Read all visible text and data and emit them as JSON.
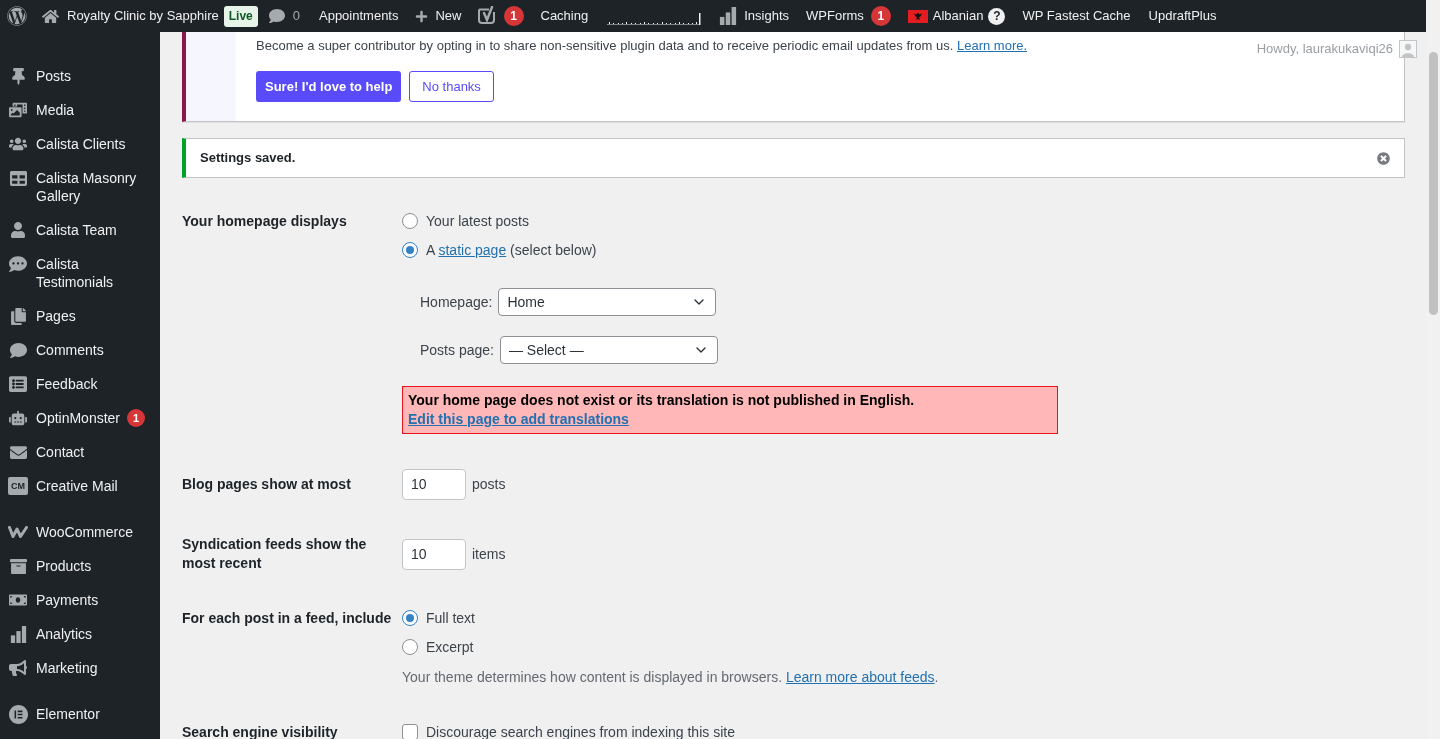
{
  "admin_bar": {
    "items": [
      {
        "kind": "logo"
      },
      {
        "kind": "site",
        "label": "Royalty Clinic by Sapphire",
        "badge": "Live"
      },
      {
        "kind": "comments",
        "count": "0"
      },
      {
        "kind": "text",
        "label": "Appointments"
      },
      {
        "kind": "new",
        "label": "New"
      },
      {
        "kind": "seo",
        "count": "1"
      },
      {
        "kind": "text",
        "label": "Caching"
      },
      {
        "kind": "stats"
      },
      {
        "kind": "insights",
        "label": "Insights"
      },
      {
        "kind": "text",
        "label": "WPForms",
        "count": "1"
      },
      {
        "kind": "language",
        "label": "Albanian",
        "help": "?"
      },
      {
        "kind": "text",
        "label": "WP Fastest Cache"
      },
      {
        "kind": "text",
        "label": "UpdraftPlus"
      }
    ]
  },
  "account": {
    "greeting": "Howdy, laurakukaviqi26"
  },
  "sidebar": {
    "groups": [
      {
        "items": [
          {
            "label": "Posts"
          },
          {
            "label": "Media"
          },
          {
            "label": "Calista Clients"
          },
          {
            "label": "Calista Masonry Gallery"
          },
          {
            "label": "Calista Team"
          },
          {
            "label": "Calista Testimonials"
          },
          {
            "label": "Pages"
          },
          {
            "label": "Comments"
          },
          {
            "label": "Feedback"
          },
          {
            "label": "OptinMonster",
            "badge": "1"
          },
          {
            "label": "Contact"
          },
          {
            "label": "Creative Mail",
            "logo_text": "CM"
          }
        ]
      },
      {
        "items": [
          {
            "label": "WooCommerce"
          },
          {
            "label": "Products"
          },
          {
            "label": "Payments"
          },
          {
            "label": "Analytics"
          },
          {
            "label": "Marketing"
          }
        ]
      },
      {
        "items": [
          {
            "label": "Elementor"
          }
        ]
      }
    ]
  },
  "optin_notice": {
    "text": "Become a super contributor by opting in to share non-sensitive plugin data and to receive periodic email updates from us.",
    "link": "Learn more.",
    "buttons": [
      {
        "label": "Sure! I'd love to help",
        "kind": "primary"
      },
      {
        "label": "No thanks",
        "kind": "secondary"
      }
    ]
  },
  "settings_notice": {
    "text": "Settings saved."
  },
  "form": {
    "rows": [
      {
        "kind": "radio",
        "label": "Your homepage displays",
        "options": [
          {
            "label": "Your latest posts",
            "selected": false
          },
          {
            "label": "A",
            "link": "static page",
            "suffix": "(select below)",
            "selected": true
          }
        ],
        "selects": [
          {
            "label": "Homepage:",
            "value": "Home"
          },
          {
            "label": "Posts page:",
            "value": "— Select —"
          }
        ],
        "error": {
          "message": "Your home page does not exist or its translation is not published in English.",
          "link": "Edit this page to add translations"
        }
      },
      {
        "kind": "number",
        "label": "Blog pages show at most",
        "value": "10",
        "unit": "posts"
      },
      {
        "kind": "number",
        "label": "Syndication feeds show the most recent",
        "value": "10",
        "unit": "items"
      },
      {
        "kind": "radio",
        "label": "For each post in a feed, include",
        "options": [
          {
            "label": "Full text",
            "selected": true
          },
          {
            "label": "Excerpt",
            "selected": false
          }
        ],
        "description": {
          "text": "Your theme determines how content is displayed in browsers.",
          "link": "Learn more about feeds",
          "suffix": "."
        }
      },
      {
        "kind": "checkbox",
        "label": "Search engine visibility",
        "option": {
          "label": "Discourage search engines from indexing this site",
          "checked": false
        }
      }
    ]
  }
}
